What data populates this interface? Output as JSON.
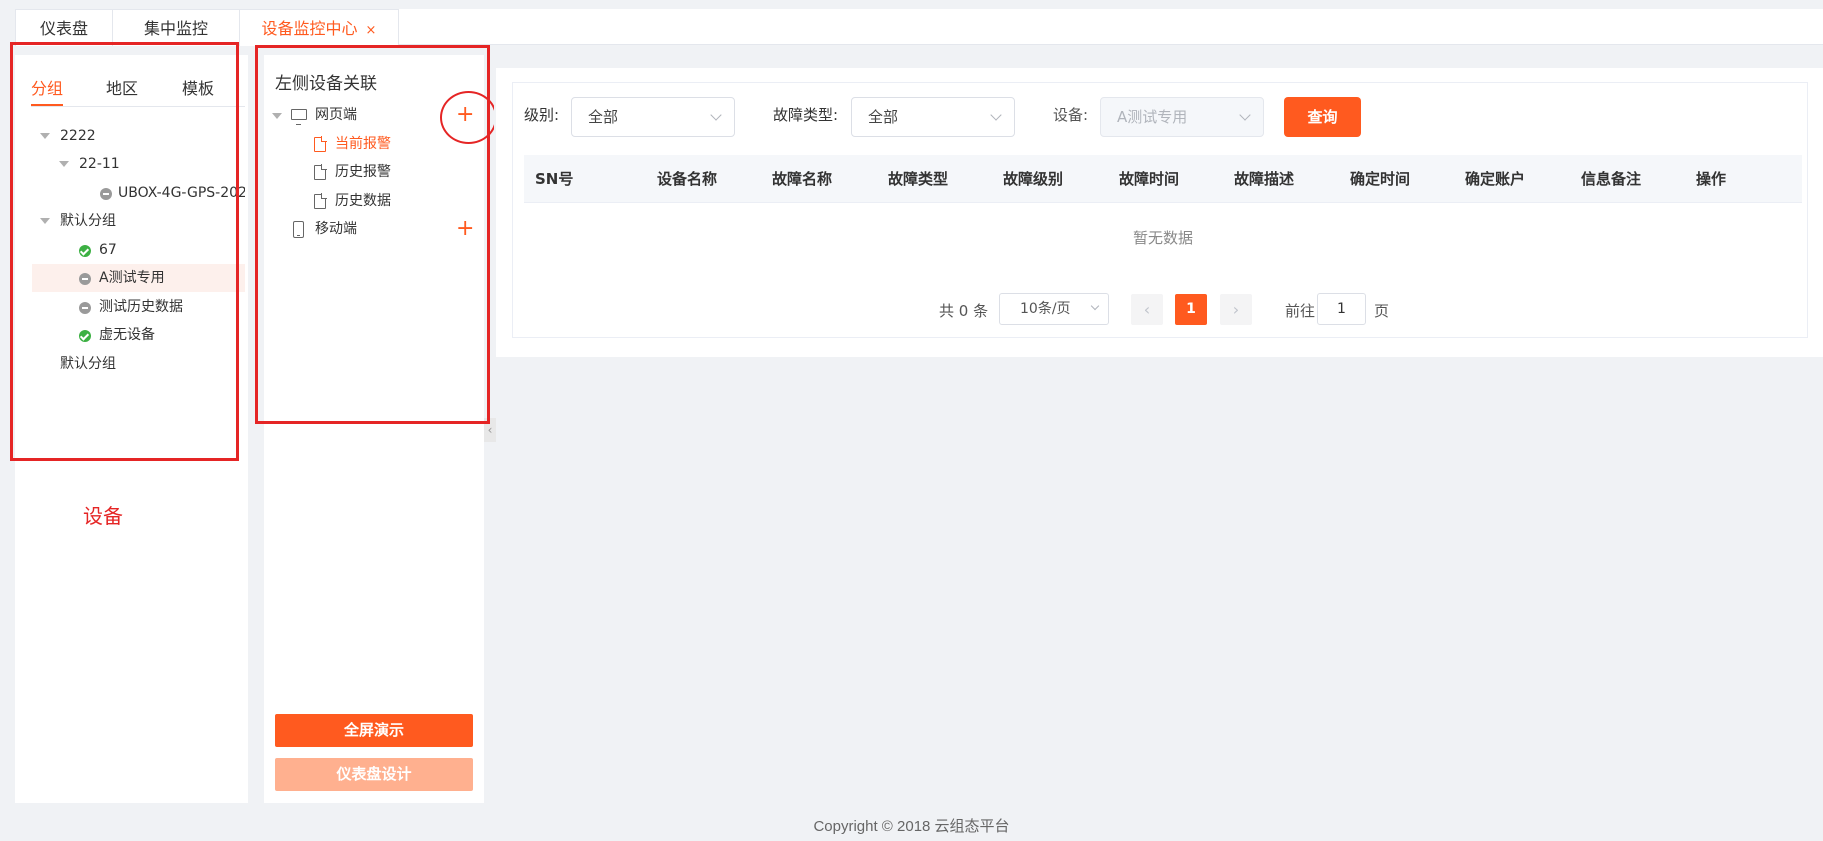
{
  "tabs": [
    {
      "label": "仪表盘"
    },
    {
      "label": "集中监控"
    },
    {
      "label": "设备监控中心",
      "close": "×"
    }
  ],
  "group_panel": {
    "tabs": [
      "分组",
      "地区",
      "模板"
    ],
    "tree": [
      {
        "label": "2222"
      },
      {
        "label": "22-11"
      },
      {
        "label": "UBOX-4G-GPS-202"
      },
      {
        "label": "默认分组"
      },
      {
        "label": "67"
      },
      {
        "label": "A测试专用"
      },
      {
        "label": "测试历史数据"
      },
      {
        "label": "虚无设备"
      },
      {
        "label": "默认分组"
      }
    ]
  },
  "annotation_label": "设备",
  "relation_panel": {
    "title": "左侧设备关联",
    "nodes": [
      {
        "label": "网页端"
      },
      {
        "label": "当前报警"
      },
      {
        "label": "历史报警"
      },
      {
        "label": "历史数据"
      },
      {
        "label": "移动端"
      }
    ],
    "plus": "+",
    "fullscreen_button": "全屏演示",
    "design_button": "仪表盘设计",
    "collapse": "‹"
  },
  "filters": {
    "level_label": "级别:",
    "level_value": "全部",
    "fault_type_label": "故障类型:",
    "fault_type_value": "全部",
    "device_label": "设备:",
    "device_value": "A测试专用",
    "query_button": "查询"
  },
  "table": {
    "columns": [
      "SN号",
      "设备名称",
      "故障名称",
      "故障类型",
      "故障级别",
      "故障时间",
      "故障描述",
      "确定时间",
      "确定账户",
      "信息备注",
      "操作"
    ],
    "empty_text": "暂无数据"
  },
  "pagination": {
    "total": "共 0 条",
    "page_size": "10条/页",
    "prev": "‹",
    "current": "1",
    "next": "›",
    "goto_label": "前往",
    "goto_value": "1",
    "page_unit": "页"
  },
  "footer": {
    "copyright": "Copyright © 2018 云组态平台"
  },
  "colors": {
    "accent": "#ff5a1f",
    "annotation_red": "#e52525",
    "online_green": "#3cb043"
  }
}
